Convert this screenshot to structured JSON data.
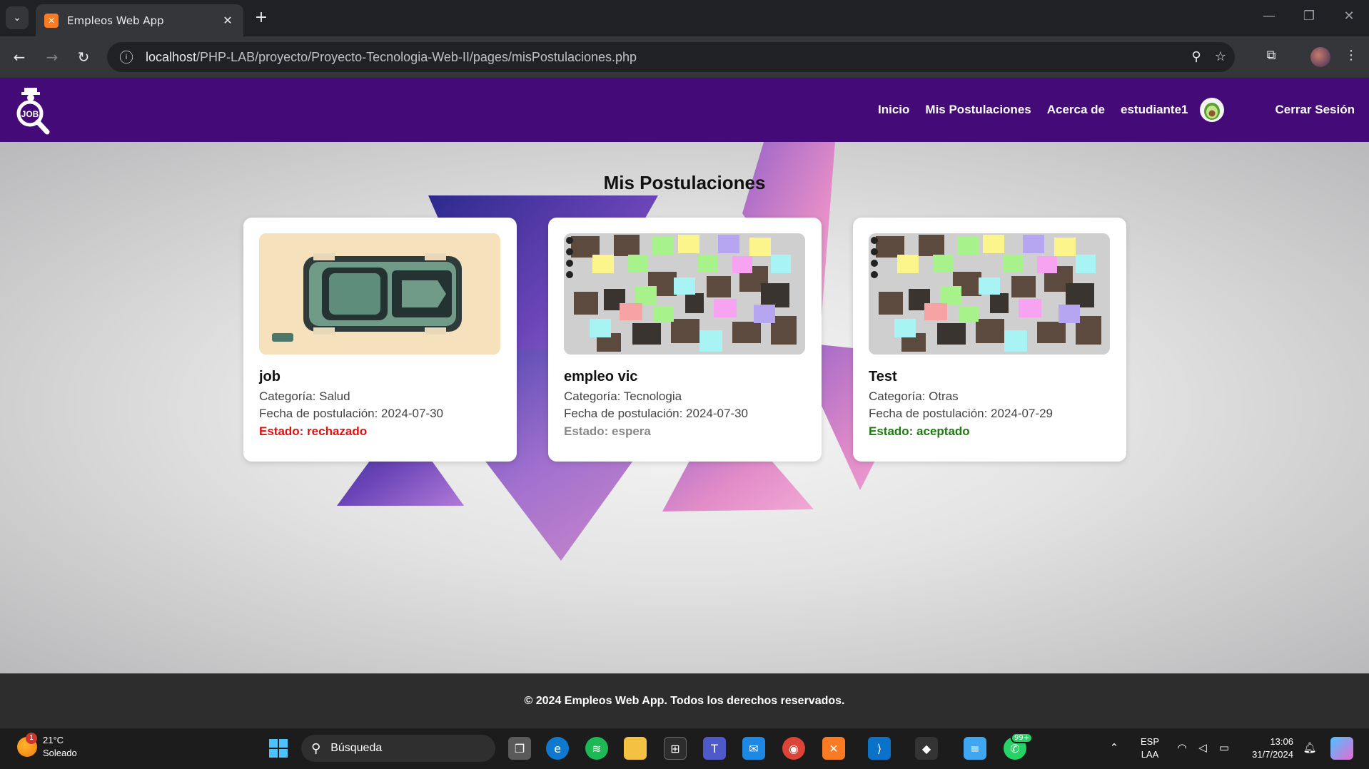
{
  "browser": {
    "tab_title": "Empleos Web App",
    "url_host": "localhost",
    "url_path": "/PHP-LAB/proyecto/Proyecto-Tecnologia-Web-II/pages/misPostulaciones.php",
    "new_tab": "+",
    "close_tab": "✕"
  },
  "site": {
    "logo_text": "JOB",
    "nav": {
      "home": "Inicio",
      "applications": "Mis Postulaciones",
      "about": "Acerca de",
      "user": "estudiante1",
      "logout": "Cerrar Sesión"
    },
    "page_title": "Mis Postulaciones",
    "cards": [
      {
        "title": "job",
        "category": "Categoría: Salud",
        "date": "Fecha de postulación: 2024-07-30",
        "status_label": "Estado: rechazado",
        "status_color": "#e01010"
      },
      {
        "title": "empleo vic",
        "category": "Categoría: Tecnologia",
        "date": "Fecha de postulación: 2024-07-30",
        "status_label": "Estado: espera",
        "status_color": "#888888"
      },
      {
        "title": "Test",
        "category": "Categoría: Otras",
        "date": "Fecha de postulación: 2024-07-29",
        "status_label": "Estado: aceptado",
        "status_color": "#1d7a0e"
      }
    ],
    "footer": "© 2024 Empleos Web App. Todos los derechos reservados.",
    "colors": {
      "header": "#430a78",
      "footer": "#2d2d2d"
    }
  },
  "taskbar": {
    "weather_temp": "21°C",
    "weather_desc": "Soleado",
    "weather_badge": "1",
    "search_placeholder": "Búsqueda",
    "whatsapp_badge": "99+",
    "lang_1": "ESP",
    "lang_2": "LAA",
    "time": "13:06",
    "date": "31/7/2024"
  }
}
